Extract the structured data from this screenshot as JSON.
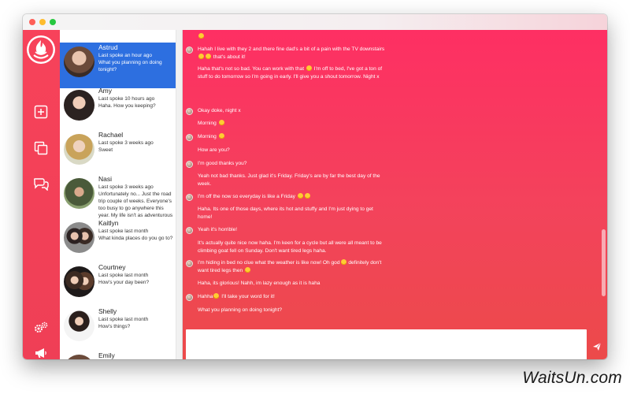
{
  "contacts": [
    {
      "name": "Astrud",
      "meta": "Last spoke an hour ago",
      "preview": "What you planning on doing tonight?"
    },
    {
      "name": "Amy",
      "meta": "Last spoke 10 hours ago",
      "preview": "Haha. How you keeping?"
    },
    {
      "name": "Rachael",
      "meta": "Last spoke 3 weeks ago",
      "preview": "Sweet"
    },
    {
      "name": "Nasi",
      "meta": "Last spoke 3 weeks ago",
      "preview": "Unfortunately no... Just the road trip couple of weeks. Everyone's too busy to go anywhere this year. My life isn't as adventurous"
    },
    {
      "name": "Kaitlyn",
      "meta": "Last spoke last month",
      "preview": "What kinda places do you go to?"
    },
    {
      "name": "Courtney",
      "meta": "Last spoke last month",
      "preview": "How's your day been?"
    },
    {
      "name": "Shelly",
      "meta": "Last spoke last month",
      "preview": "How's things?"
    },
    {
      "name": "Emily",
      "meta": "",
      "preview": ""
    }
  ],
  "messages": [
    {
      "text": "",
      "emoji_after": 1
    },
    {
      "text": "Hahah I live with they 2 and there fine dad's a bit of a pain with the TV downstairs",
      "text2": "that's about it!",
      "emoji_mid": 2
    },
    {
      "text": "Haha that's not so bad. You can work with that",
      "text1b": "I'm off to bed, I've got a ton of",
      "text2": "stuff to do tomorrow so I'm going in early. I'll give you a shout tomorrow. Night x"
    },
    {
      "text": "Okay doke, night x"
    },
    {
      "text": "Morning"
    },
    {
      "text": "Morning"
    },
    {
      "text": "How are you?"
    },
    {
      "text": "I'm good thanks you?"
    },
    {
      "text": "Yeah not bad thanks. Just glad it's Friday. Friday's are by far the best day of the",
      "text2": "week."
    },
    {
      "text": "I'm off the now so everyday is like a Friday"
    },
    {
      "text": "Haha. Its one of those days, where its hot and stuffy and I'm just dying to get",
      "text2": "home!"
    },
    {
      "text": "Yeah it's horrible!"
    },
    {
      "text": "It's actually quite nice now haha. I'm keen for a cycle but all were all meant to be",
      "text2": "climbing goat fell on Sunday. Don't want tired legs haha."
    },
    {
      "text": "I'm hiding in bed no clue what the weather is like now! Oh god",
      "text1b": "definitely don't",
      "text2": "want tired legs then"
    },
    {
      "text": "Haha, its glorious! Nahh, im lazy enough as it is haha"
    },
    {
      "text": "Hahha",
      "text1b": "I'll take your word for it!"
    },
    {
      "text": "What you planning on doing tonight?"
    }
  ],
  "composer": {
    "placeholder": ""
  },
  "watermark": "WaitsUn.com",
  "colors": {
    "accent": "#fe2f63",
    "active_contact": "#2d6fe0",
    "rail": "#f7425a"
  }
}
